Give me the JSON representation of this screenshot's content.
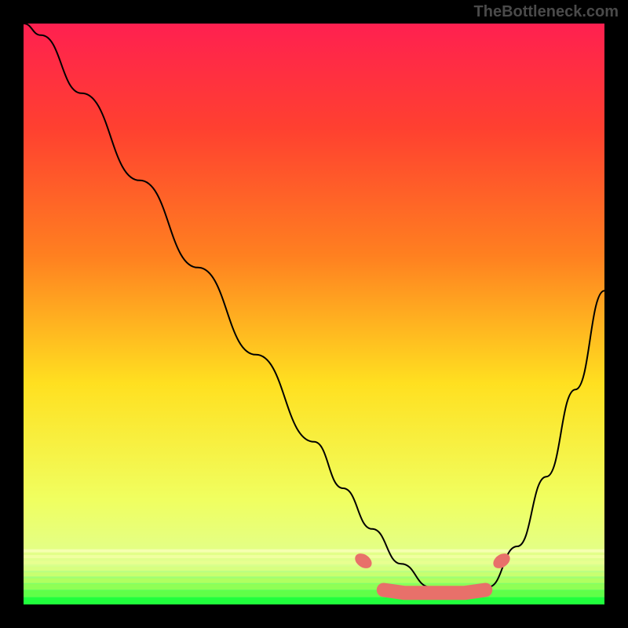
{
  "watermark": "TheBottleneck.com",
  "chart_data": {
    "type": "line",
    "title": "",
    "xlabel": "",
    "ylabel": "",
    "xlim": [
      0,
      1
    ],
    "ylim": [
      0,
      1
    ],
    "background_gradient": {
      "top": "#ff2050",
      "upper_mid": "#ff8020",
      "mid": "#ffe020",
      "lower_mid": "#f0ff60",
      "bottom_band": "#e0ff90",
      "bottom": "#20ff40"
    },
    "series": [
      {
        "name": "bottleneck-curve",
        "x": [
          0.0,
          0.03,
          0.1,
          0.2,
          0.3,
          0.4,
          0.5,
          0.55,
          0.6,
          0.65,
          0.7,
          0.73,
          0.76,
          0.8,
          0.85,
          0.9,
          0.95,
          1.0
        ],
        "y": [
          1.0,
          0.98,
          0.88,
          0.73,
          0.58,
          0.43,
          0.28,
          0.2,
          0.13,
          0.07,
          0.03,
          0.015,
          0.015,
          0.03,
          0.1,
          0.22,
          0.37,
          0.54
        ],
        "stroke": "#000000",
        "stroke_width": 2
      }
    ],
    "markers": {
      "name": "highlight-band",
      "color": "#e8706a",
      "points": [
        {
          "x": 0.585,
          "y": 0.075
        },
        {
          "x": 0.62,
          "y": 0.025
        },
        {
          "x": 0.655,
          "y": 0.02
        },
        {
          "x": 0.69,
          "y": 0.02
        },
        {
          "x": 0.725,
          "y": 0.02
        },
        {
          "x": 0.76,
          "y": 0.02
        },
        {
          "x": 0.795,
          "y": 0.025
        },
        {
          "x": 0.823,
          "y": 0.075
        }
      ],
      "radius": 9
    }
  }
}
